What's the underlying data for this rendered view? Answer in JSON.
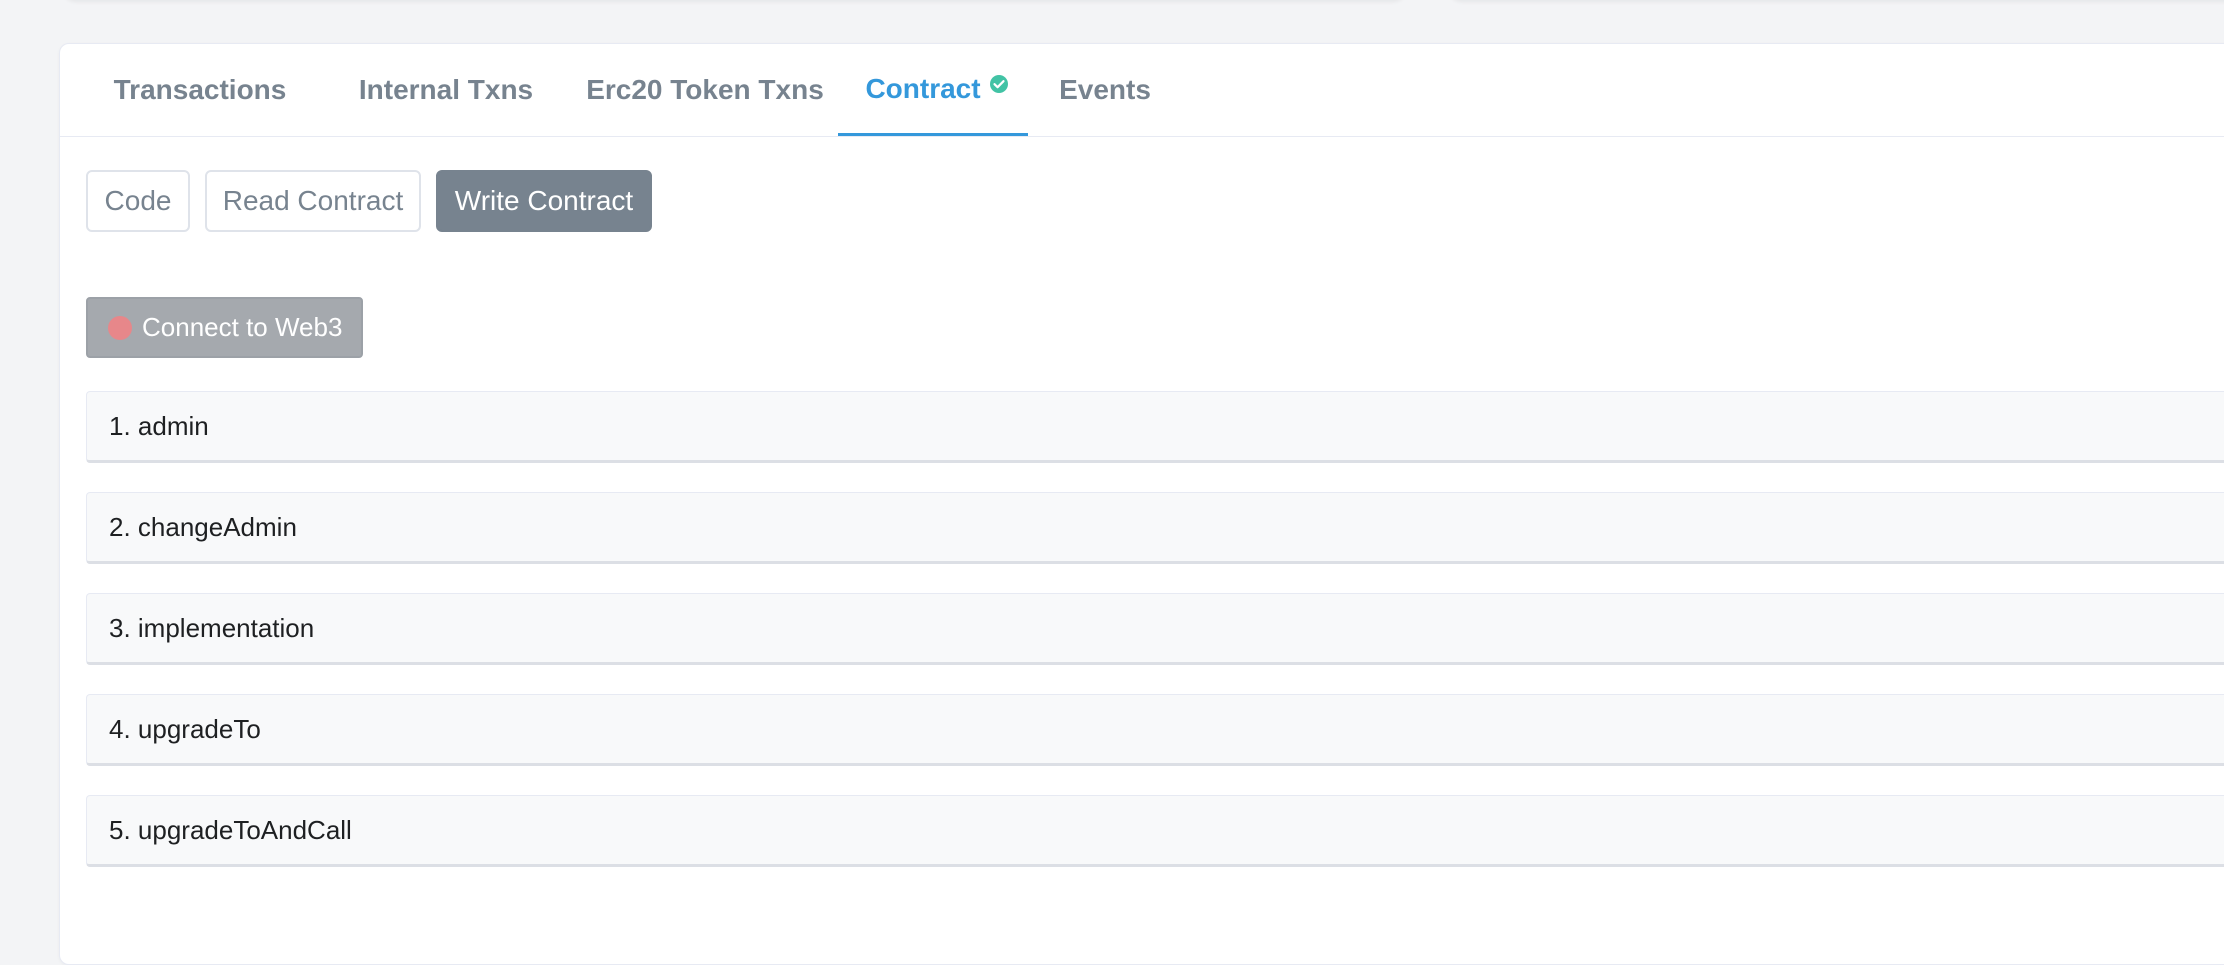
{
  "tabs": [
    {
      "label": "Transactions",
      "active": false
    },
    {
      "label": "Internal Txns",
      "active": false
    },
    {
      "label": "Erc20 Token Txns",
      "active": false
    },
    {
      "label": "Contract",
      "active": true,
      "verified": true
    },
    {
      "label": "Events",
      "active": false
    }
  ],
  "subnav": {
    "code": "Code",
    "read": "Read Contract",
    "write": "Write Contract",
    "selected": "Write Contract"
  },
  "connect": {
    "label": "Connect to Web3",
    "status": "disconnected"
  },
  "functions": [
    {
      "label": "1. admin"
    },
    {
      "label": "2. changeAdmin"
    },
    {
      "label": "3. implementation"
    },
    {
      "label": "4. upgradeTo"
    },
    {
      "label": "5. upgradeToAndCall"
    }
  ],
  "colors": {
    "accent": "#3498db",
    "verified": "#42c3a5",
    "muted": "#77838f",
    "status_disconnected": "#e7878a"
  },
  "icons": {
    "verified": "check-circle-icon",
    "status": "status-dot-icon"
  }
}
